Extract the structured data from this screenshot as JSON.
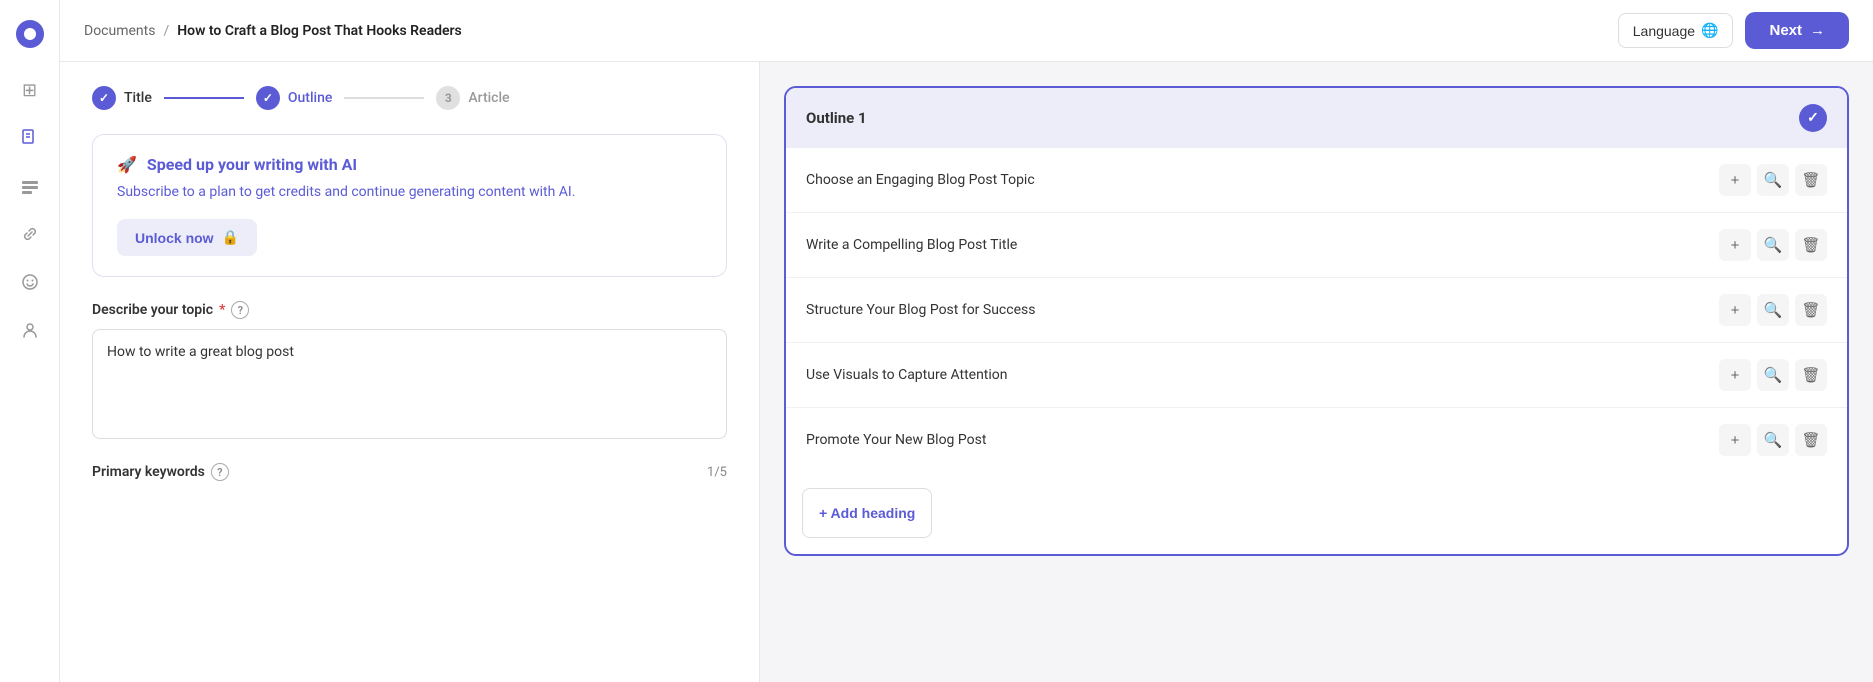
{
  "sidebar": {
    "logo_alt": "App logo",
    "icons": [
      {
        "name": "home-icon",
        "symbol": "⊞",
        "active": false
      },
      {
        "name": "document-icon",
        "symbol": "📄",
        "active": true
      },
      {
        "name": "layers-icon",
        "symbol": "◧",
        "active": false
      },
      {
        "name": "link-icon",
        "symbol": "↺",
        "active": false
      },
      {
        "name": "emoji-icon",
        "symbol": "☺",
        "active": false
      },
      {
        "name": "person-icon",
        "symbol": "⛰",
        "active": false
      }
    ]
  },
  "header": {
    "breadcrumb_root": "Documents",
    "breadcrumb_sep": "/",
    "breadcrumb_current": "How to Craft a Blog Post That Hooks Readers",
    "language_button": "Language",
    "language_icon": "🌐",
    "next_button": "Next"
  },
  "steps": [
    {
      "label": "Title",
      "state": "done",
      "number": "✓"
    },
    {
      "label": "Outline",
      "state": "active",
      "number": "✓"
    },
    {
      "label": "Article",
      "state": "inactive",
      "number": "3"
    }
  ],
  "ai_banner": {
    "icon": "🚀",
    "title": "Speed up your writing with AI",
    "description": "Subscribe to a plan to get credits and continue generating content with AI.",
    "unlock_button": "Unlock now",
    "lock_icon": "🔒"
  },
  "form": {
    "topic_label": "Describe your topic",
    "topic_required": "*",
    "topic_value": "How to write a great blog post",
    "keywords_label": "Primary keywords",
    "keywords_count": "1/5"
  },
  "outline": {
    "title": "Outline 1",
    "items": [
      "Choose an Engaging Blog Post Topic",
      "Write a Compelling Blog Post Title",
      "Structure Your Blog Post for Success",
      "Use Visuals to Capture Attention",
      "Promote Your New Blog Post"
    ],
    "add_heading_label": "+ Add heading"
  },
  "colors": {
    "accent": "#5b5bd6",
    "accent_light": "#ededfa"
  }
}
